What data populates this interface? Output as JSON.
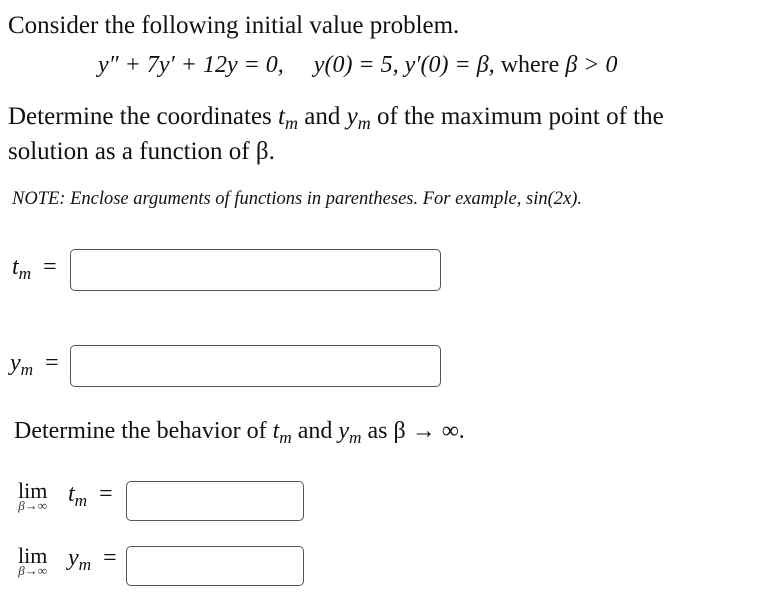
{
  "intro": "Consider the following initial value problem.",
  "equation": {
    "ode": "y″ + 7y′ + 12y = 0,",
    "ic1": "y(0) = 5,",
    "ic2": "y′(0) = β,",
    "where": "where",
    "condition": "β > 0"
  },
  "prompt1": {
    "part1": "Determine the coordinates",
    "t": "t",
    "m": "m",
    "and": "and",
    "y": "y",
    "part2": "of the maximum point of the",
    "line2": "solution as a function of β."
  },
  "note": "NOTE: Enclose arguments of functions in parentheses. For example, sin(2x).",
  "answers": {
    "tm": {
      "var": "t",
      "sub": "m",
      "eq": "=",
      "value": ""
    },
    "ym": {
      "var": "y",
      "sub": "m",
      "eq": "=",
      "value": ""
    }
  },
  "prompt2": {
    "part1": "Determine the behavior of",
    "t": "t",
    "m": "m",
    "and": "and",
    "y": "y",
    "part2": "as β → ∞."
  },
  "limits": [
    {
      "lim": "lim",
      "under": "β→∞",
      "var": "t",
      "sub": "m",
      "eq": "=",
      "value": ""
    },
    {
      "lim": "lim",
      "under": "β→∞",
      "var": "y",
      "sub": "m",
      "eq": "=",
      "value": ""
    }
  ]
}
